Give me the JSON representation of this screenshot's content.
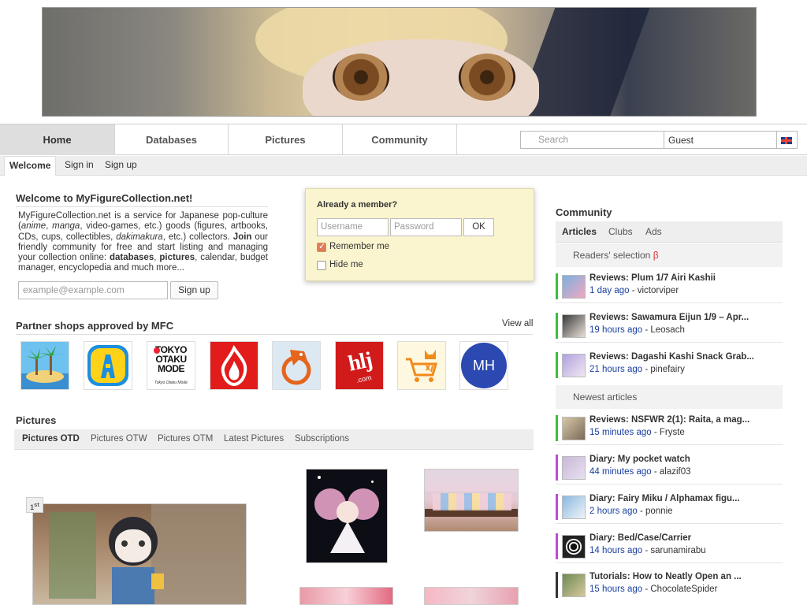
{
  "nav": {
    "tabs": [
      "Home",
      "Databases",
      "Pictures",
      "Community"
    ],
    "search_placeholder": "Search",
    "user": "Guest"
  },
  "subnav": [
    "Welcome",
    "Sign in",
    "Sign up"
  ],
  "welcome": {
    "title": "Welcome to MyFigureCollection.net!",
    "text_html": "MyFigureCollection.net is a service for Japanese pop-culture (<i>anime</i>, <i>manga</i>, video-games, etc.) goods (figures, artbooks, CDs, cups, collectibles, <i>dakimakura</i>, etc.) collectors. <b>Join</b> our friendly community for free and start listing and managing your collection online: <b>databases</b>, <b>pictures</b>, calendar, budget manager, encyclopedia and much more...",
    "email_placeholder": "example@example.com",
    "signup_label": "Sign up"
  },
  "login": {
    "title": "Already a member?",
    "username_placeholder": "Username",
    "password_placeholder": "Password",
    "ok_label": "OK",
    "remember_label": "Remember me",
    "remember_checked": true,
    "hide_label": "Hide me",
    "hide_checked": false
  },
  "partners": {
    "title": "Partner shops approved by MFC",
    "view_all": "View all",
    "logo_text": [
      "TOKYO OTAKU MODE",
      "Tokyo Otaku Mode",
      "hlj",
      ".com",
      "MH"
    ],
    "shops": [
      "island-logo",
      "yellow-a-logo",
      "tokyo-otaku-mode-logo",
      "red-flame-logo",
      "orange-dragon-logo",
      "hlj-logo",
      "cat-cart-logo",
      "mh-logo"
    ]
  },
  "pictures": {
    "title": "Pictures",
    "tabs": [
      "Pictures OTD",
      "Pictures OTW",
      "Pictures OTM",
      "Latest Pictures",
      "Subscriptions"
    ],
    "rank_num": "1",
    "rank_suffix": "st"
  },
  "community": {
    "title": "Community",
    "tabs": [
      "Articles",
      "Clubs",
      "Ads"
    ],
    "readers_selection": "Readers' selection",
    "beta": "β",
    "newest": "Newest articles",
    "readers": [
      {
        "title": "Reviews: Plum 1/7 Airi Kashii",
        "ago": "1 day ago",
        "user": "victorviper",
        "color": "#3cbd3c"
      },
      {
        "title": "Reviews: Sawamura Eijun 1/9 – Apr...",
        "ago": "19 hours ago",
        "user": "Leosach",
        "color": "#3cbd3c"
      },
      {
        "title": "Reviews: Dagashi Kashi Snack Grab...",
        "ago": "21 hours ago",
        "user": "pinefairy",
        "color": "#3cbd3c"
      }
    ],
    "newest_items": [
      {
        "title": "Reviews: NSFWR 2(1): Raita, a mag...",
        "ago": "15 minutes ago",
        "user": "Fryste",
        "color": "#3cbd3c"
      },
      {
        "title": "Diary: My pocket watch",
        "ago": "44 minutes ago",
        "user": "alazif03",
        "color": "#c04ad8"
      },
      {
        "title": "Diary: Fairy Miku / Alphamax figu...",
        "ago": "2 hours ago",
        "user": "ponnie",
        "color": "#c04ad8"
      },
      {
        "title": "Diary: Bed/Case/Carrier",
        "ago": "14 hours ago",
        "user": "sarunamirabu",
        "color": "#c04ad8"
      },
      {
        "title": "Tutorials: How to Neatly Open an ...",
        "ago": "15 hours ago",
        "user": "ChocolateSpider",
        "color": "#333333"
      }
    ]
  }
}
